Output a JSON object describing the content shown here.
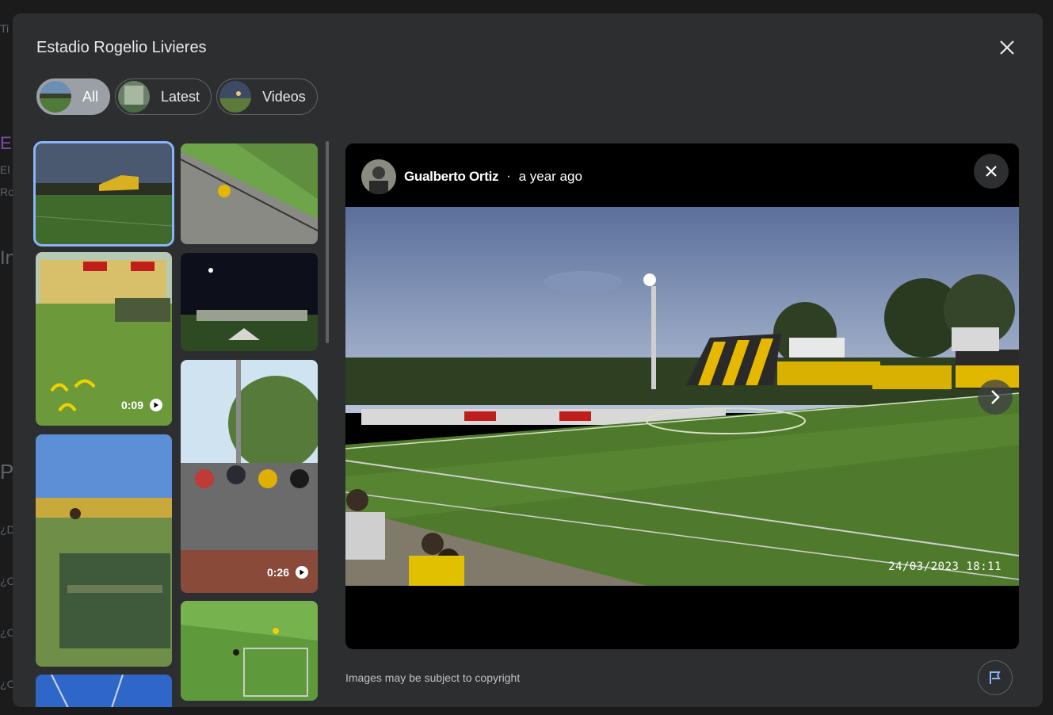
{
  "modal": {
    "title": "Estadio Rogelio Livieres"
  },
  "chips": [
    {
      "label": "All",
      "selected": true
    },
    {
      "label": "Latest",
      "selected": false
    },
    {
      "label": "Videos",
      "selected": false
    }
  ],
  "thumbnails": {
    "videos": [
      {
        "duration": "0:09"
      },
      {
        "duration": "0:26"
      }
    ]
  },
  "viewer": {
    "author": "Gualberto Ortiz",
    "separator": "·",
    "posted": "a year ago",
    "timestamp": "24/03/2023 18:11"
  },
  "footer": {
    "copyright": "Images may be subject to copyright"
  },
  "background": {
    "fragments": [
      "Ti",
      "E",
      "El",
      "Ro",
      "In",
      "P",
      "¿D",
      "¿C",
      "¿C",
      "¿C"
    ]
  },
  "icons": [
    "close-icon",
    "play-icon",
    "chevron-right-icon",
    "flag-icon"
  ],
  "colors": {
    "accent": "#8ab4f8",
    "modal_bg": "#2d2e30",
    "viewer_bg": "#000000"
  }
}
